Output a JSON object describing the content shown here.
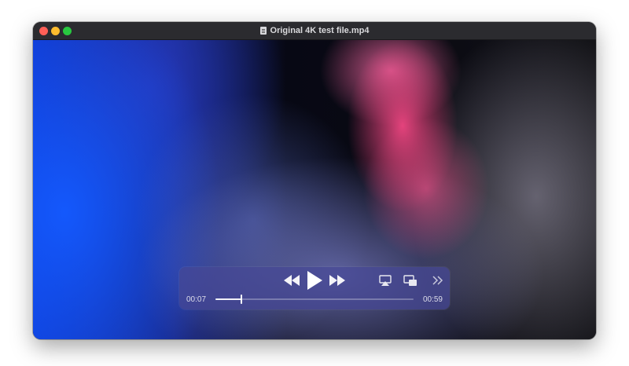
{
  "window": {
    "title": "Original 4K test file.mp4",
    "title_icon": "document-icon"
  },
  "controls": {
    "current_time": "00:07",
    "total_time": "00:59",
    "progress": 0.13,
    "buttons": {
      "rewind": "rewind-icon",
      "play": "play-icon",
      "fast_forward": "fast-forward-icon",
      "airplay": "airplay-icon",
      "picture_in_picture": "picture-in-picture-icon",
      "more": "chevron-double-right-icon"
    }
  },
  "colors": {
    "close": "#ff5f57",
    "minimize": "#febc2e",
    "maximize": "#28c840"
  }
}
